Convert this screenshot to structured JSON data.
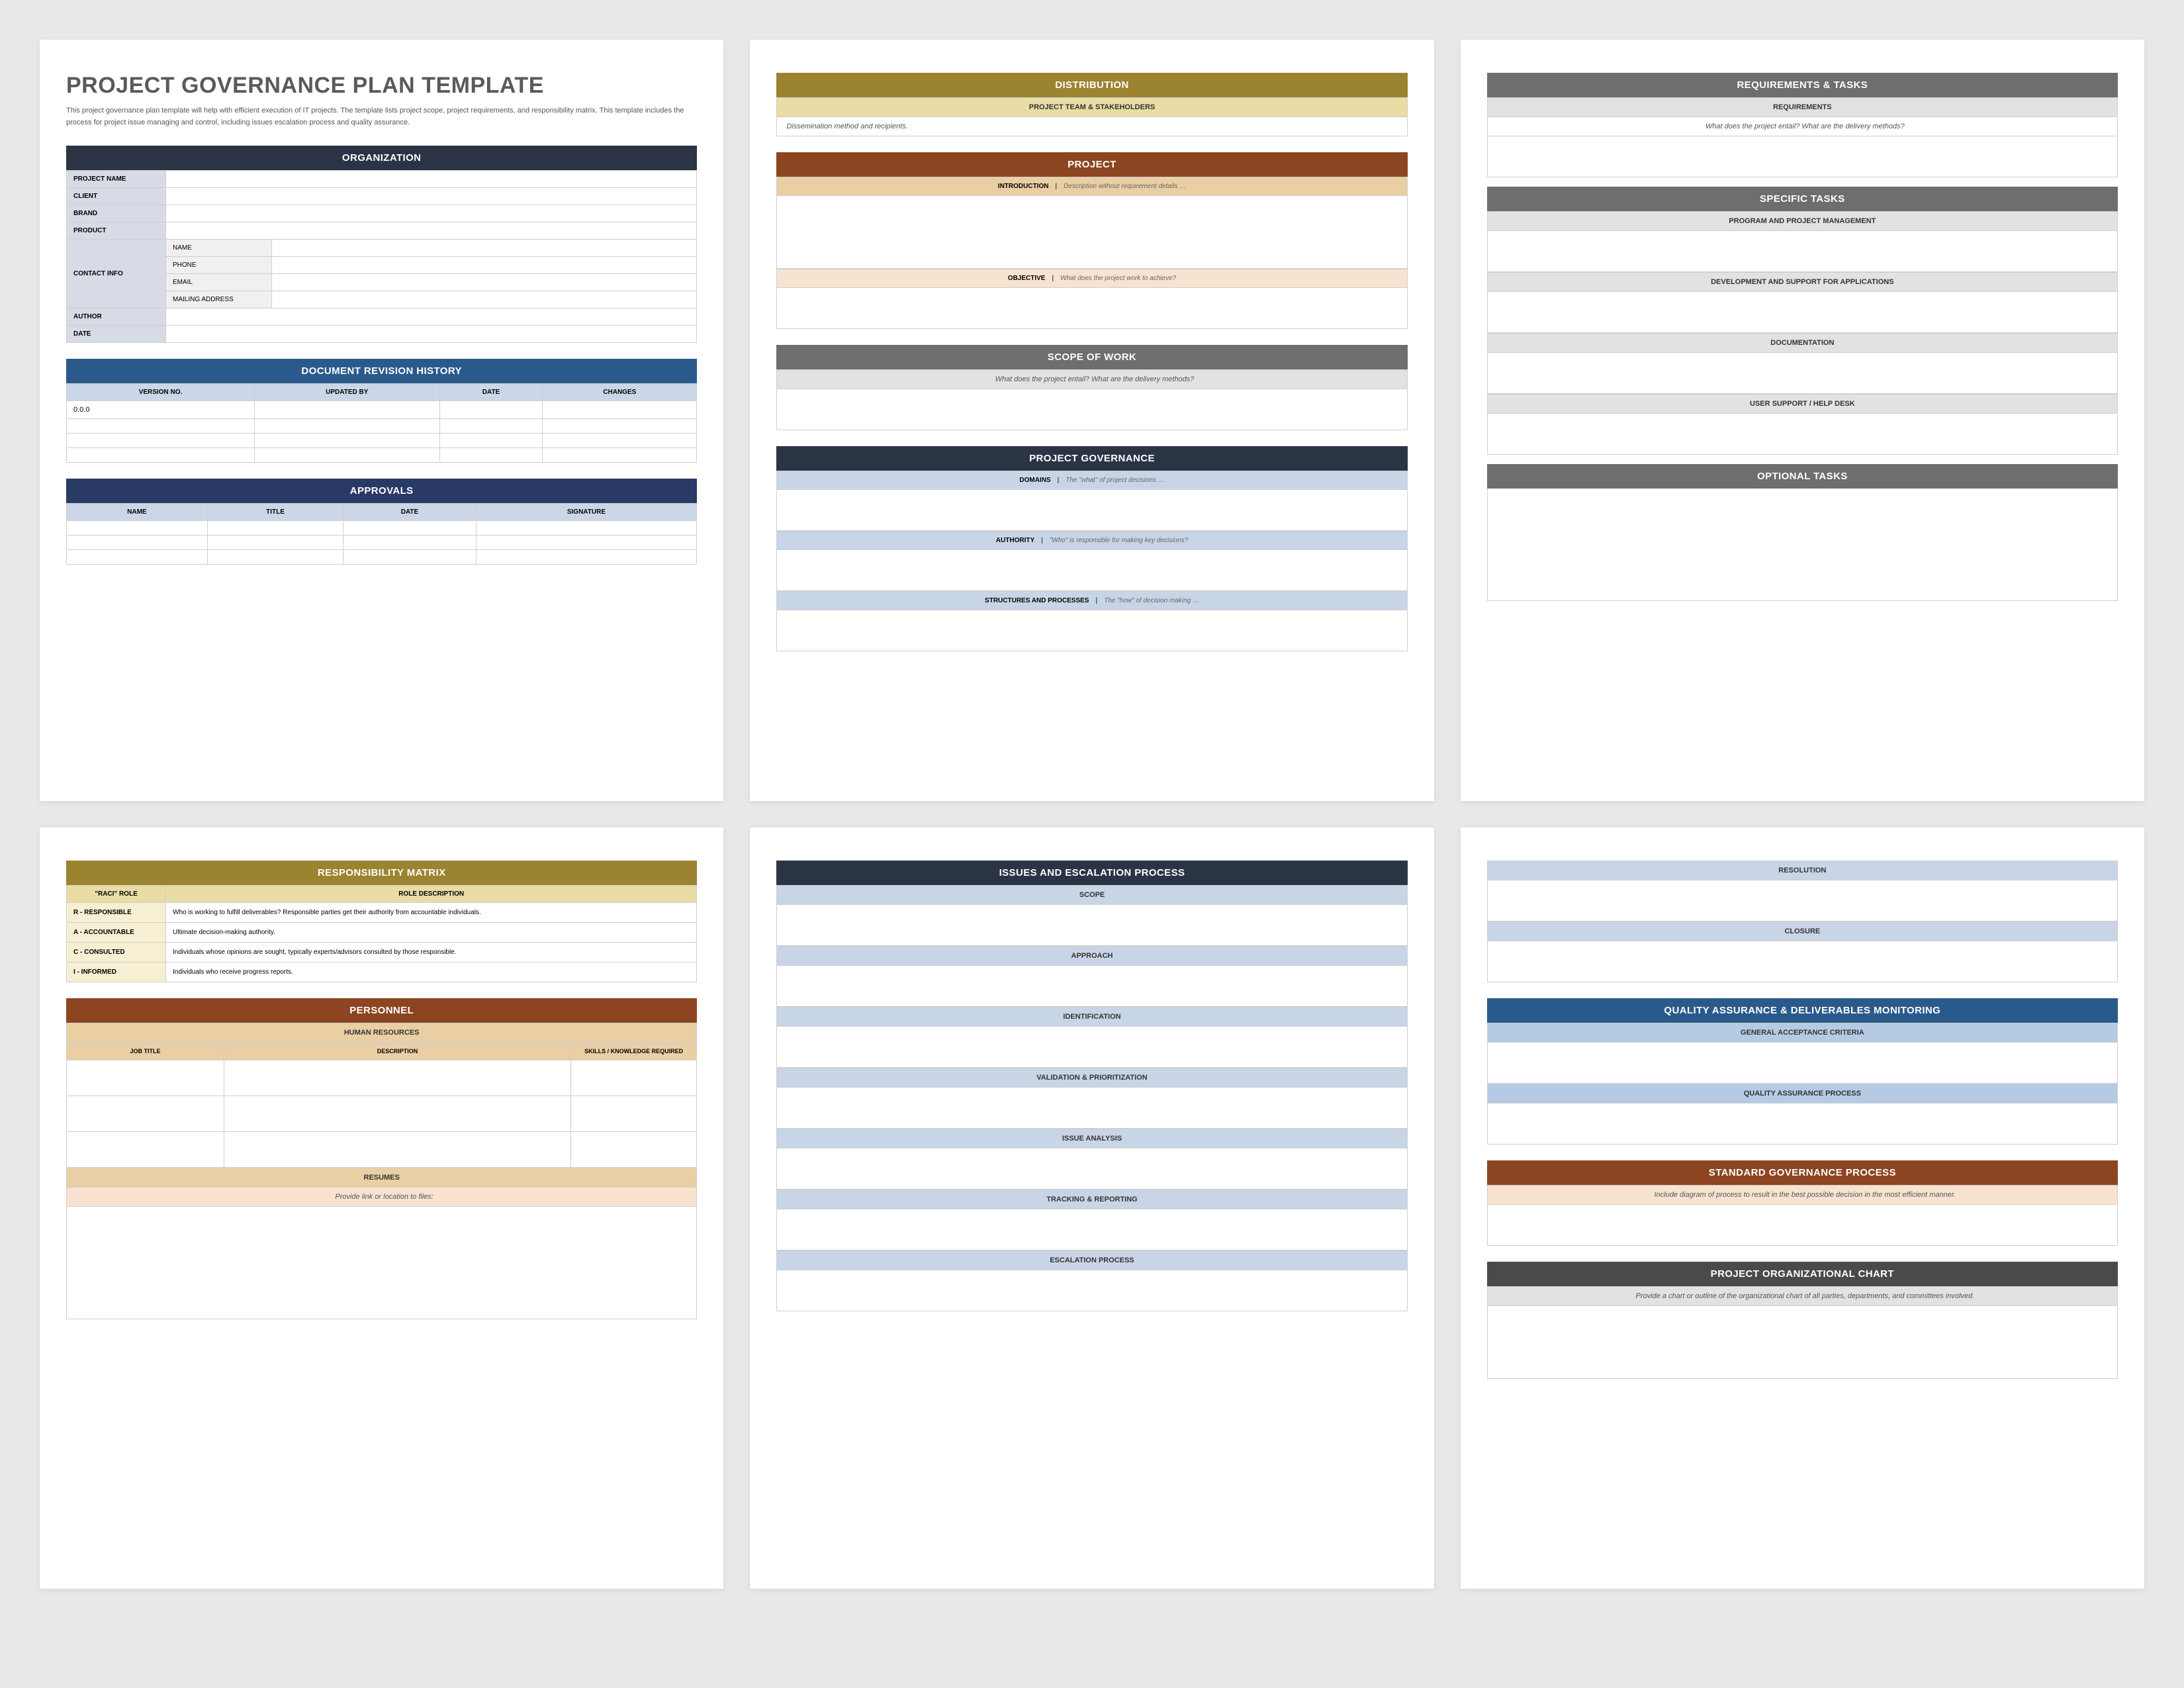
{
  "colors": {
    "dark": "#2a3444",
    "navy": "#2a3a66",
    "gold": "#9b8330",
    "rust": "#8c4520",
    "gray": "#6e6e6e",
    "blue": "#2a5a8c",
    "darkgray": "#4a4a4a"
  },
  "page1": {
    "title": "PROJECT GOVERNANCE PLAN TEMPLATE",
    "desc": "This project governance plan template will help with efficient execution of IT projects. The template lists project scope, project requirements, and responsibility matrix. This template includes the process for project issue managing and control, including issues escalation process and quality assurance.",
    "org_header": "ORGANIZATION",
    "org_rows": {
      "project_name": "PROJECT NAME",
      "client": "CLIENT",
      "brand": "BRAND",
      "product": "PRODUCT",
      "contact_info": "CONTACT INFO",
      "contact_name": "NAME",
      "contact_phone": "PHONE",
      "contact_email": "EMAIL",
      "contact_mail": "MAILING ADDRESS",
      "author": "AUTHOR",
      "date": "DATE"
    },
    "revision_header": "DOCUMENT REVISION HISTORY",
    "revision_cols": [
      "VERSION NO.",
      "UPDATED BY",
      "DATE",
      "CHANGES"
    ],
    "revision_first": "0.0.0",
    "approvals_header": "APPROVALS",
    "approvals_cols": [
      "NAME",
      "TITLE",
      "DATE",
      "SIGNATURE"
    ]
  },
  "page2": {
    "distribution_header": "DISTRIBUTION",
    "distribution_sub": "PROJECT TEAM & STAKEHOLDERS",
    "distribution_hint": "Dissemination method and recipients.",
    "project_header": "PROJECT",
    "intro_label": "INTRODUCTION",
    "intro_hint": "Description without requirement details …",
    "objective_label": "OBJECTIVE",
    "objective_hint": "What does the project work to achieve?",
    "scope_header": "SCOPE OF WORK",
    "scope_hint": "What does the project entail? What are the delivery methods?",
    "gov_header": "PROJECT GOVERNANCE",
    "domains_label": "DOMAINS",
    "domains_hint": "The \"what\" of project decisions …",
    "authority_label": "AUTHORITY",
    "authority_hint": "\"Who\" is responsible for making key decisions?",
    "struct_label": "STRUCTURES AND PROCESSES",
    "struct_hint": "The \"how\" of decision making …"
  },
  "page3": {
    "req_header": "REQUIREMENTS & TASKS",
    "req_sub": "REQUIREMENTS",
    "req_hint": "What does the project entail? What are the delivery methods?",
    "tasks_header": "SPECIFIC TASKS",
    "task_labels": [
      "PROGRAM AND PROJECT MANAGEMENT",
      "DEVELOPMENT AND SUPPORT FOR APPLICATIONS",
      "DOCUMENTATION",
      "USER SUPPORT / HELP DESK"
    ],
    "optional_header": "OPTIONAL TASKS"
  },
  "page4": {
    "resp_header": "RESPONSIBILITY MATRIX",
    "resp_cols": [
      "\"RACI\" ROLE",
      "ROLE DESCRIPTION"
    ],
    "resp_rows": [
      {
        "role": "R - RESPONSIBLE",
        "desc": "Who is working to fulfill deliverables? Responsible parties get their authority from accountable individuals."
      },
      {
        "role": "A - ACCOUNTABLE",
        "desc": "Ultimate decision-making authority."
      },
      {
        "role": "C - CONSULTED",
        "desc": "Individuals whose opinions are sought, typically experts/advisors consulted by those responsible."
      },
      {
        "role": "I - INFORMED",
        "desc": "Individuals who receive progress reports."
      }
    ],
    "pers_header": "PERSONNEL",
    "pers_sub": "HUMAN RESOURCES",
    "pers_cols": [
      "JOB TITLE",
      "DESCRIPTION",
      "SKILLS / KNOWLEDGE REQUIRED"
    ],
    "resumes_header": "RESUMES",
    "resumes_hint": "Provide link or location to files:"
  },
  "page5": {
    "issues_header": "ISSUES AND ESCALATION PROCESS",
    "sections": [
      "SCOPE",
      "APPROACH",
      "IDENTIFICATION",
      "VALIDATION & PRIORITIZATION",
      "ISSUE ANALYSIS",
      "TRACKING & REPORTING",
      "ESCALATION PROCESS"
    ]
  },
  "page6": {
    "top_sections": [
      "RESOLUTION",
      "CLOSURE"
    ],
    "qa_header": "QUALITY ASSURANCE & DELIVERABLES MONITORING",
    "qa_sections": [
      "GENERAL ACCEPTANCE CRITERIA",
      "QUALITY ASSURANCE PROCESS"
    ],
    "std_header": "STANDARD GOVERNANCE PROCESS",
    "std_hint": "Include diagram of process to result in the best possible decision in the most efficient manner.",
    "org_header": "PROJECT ORGANIZATIONAL CHART",
    "org_hint": "Provide a chart or outline of the organizational chart of all parties, departments, and committees involved."
  }
}
